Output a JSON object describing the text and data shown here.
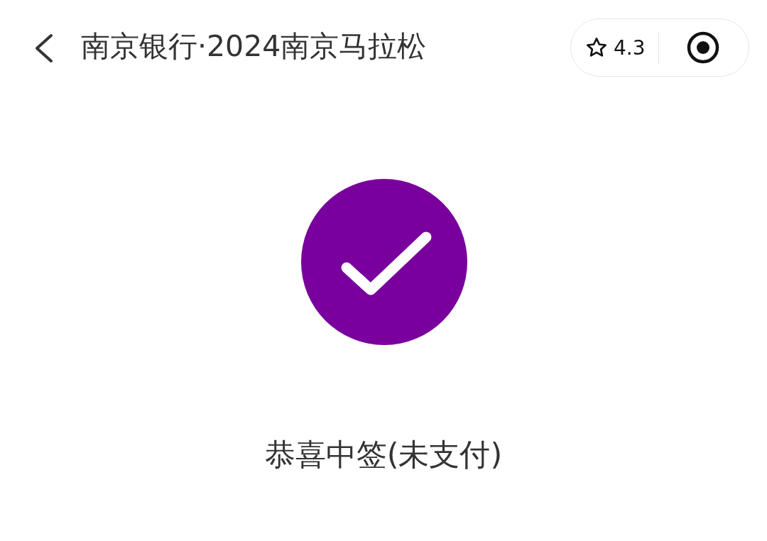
{
  "header": {
    "title": "南京银行·2024南京马拉松",
    "rating": "4.3"
  },
  "result": {
    "status": "恭喜中签(未支付)"
  }
}
